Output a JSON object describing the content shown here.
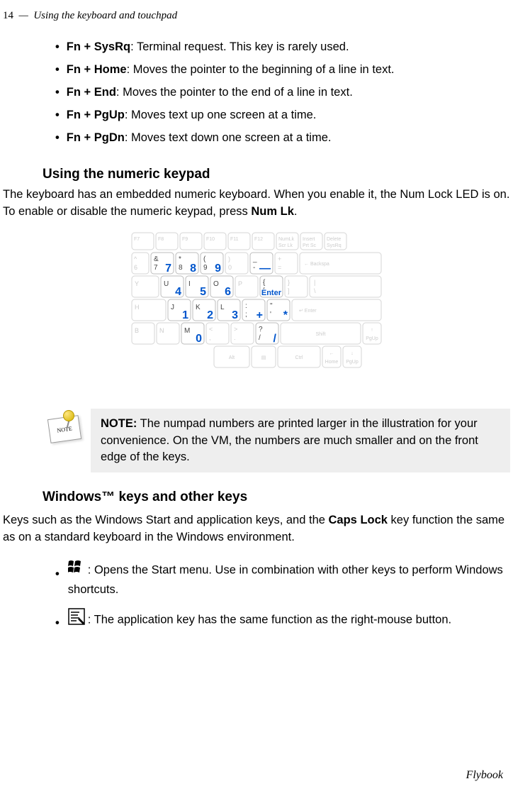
{
  "header": {
    "page_number": "14",
    "separator": "—",
    "chapter_title": "Using the keyboard and touchpad"
  },
  "bullets": {
    "items": [
      {
        "term": "Fn + SysRq",
        "desc": ": Terminal request. This key is rarely used."
      },
      {
        "term": "Fn + Home",
        "desc": ": Moves the pointer to the beginning of a line in text."
      },
      {
        "term": "Fn + End",
        "desc": ": Moves the pointer to the end of a line in text."
      },
      {
        "term": "Fn + PgUp",
        "desc": ": Moves text up one screen at a time."
      },
      {
        "term": "Fn + PgDn",
        "desc": ": Moves text down one screen at a time."
      }
    ]
  },
  "heading_numeric": "Using the numeric keypad",
  "para_numeric": {
    "pre": "The keyboard has an embedded numeric keyboard. When you enable it, the Num Lock LED is on. To enable or disable the numeric keypad, press ",
    "bold": "Num Lk",
    "post": "."
  },
  "note": {
    "label": "NOTE:",
    "text": " The numpad numbers are printed larger in the illustration for your convenience. On the VM, the numbers are much smaller and on the front edge of the keys.",
    "icon_text": "NOTE"
  },
  "heading_winkeys": "Windows™ keys and other keys",
  "para_winkeys": {
    "pre": "Keys such as the Windows Start and application keys, and the ",
    "bold": "Caps Lock",
    "post": " key function the same as on a standard keyboard in the Windows environment."
  },
  "winlist": {
    "items": [
      {
        "desc": ": Opens the Start menu. Use in combination with other keys to perform Windows shortcuts."
      },
      {
        "desc": ": The application key has the same function as the right-mouse button."
      }
    ]
  },
  "footer": "Flybook",
  "keyboard": {
    "fn_row": [
      {
        "label": "F7"
      },
      {
        "label": "F8"
      },
      {
        "label": "F9"
      },
      {
        "label": "F10"
      },
      {
        "label": "F11"
      },
      {
        "label": "F12"
      },
      {
        "label": "NumLk",
        "sub": "Scr Lk"
      },
      {
        "label": "Insert",
        "sub": "Prt Sc"
      },
      {
        "label": "Delete",
        "sub": "SysRq"
      }
    ],
    "row1": {
      "keys": [
        {
          "top": "^",
          "bottom": "6"
        },
        {
          "top": "&",
          "bottom": "7",
          "num": "7",
          "active": true
        },
        {
          "top": "*",
          "bottom": "8",
          "num": "8",
          "active": true
        },
        {
          "top": "(",
          "bottom": "9",
          "num": "9",
          "active": true
        },
        {
          "top": ")",
          "bottom": "0"
        },
        {
          "top": "_",
          "bottom": "-",
          "num": "—",
          "active": true
        },
        {
          "top": "+",
          "bottom": "="
        }
      ],
      "end": {
        "label": "← Backspa"
      }
    },
    "row2": {
      "start": {
        "label": "Y"
      },
      "keys": [
        {
          "label": "U",
          "num": "4",
          "active": true
        },
        {
          "label": "I",
          "num": "5",
          "active": true
        },
        {
          "label": "O",
          "num": "6",
          "active": true
        },
        {
          "label": "P"
        },
        {
          "top": "{",
          "bottom": "[",
          "num": "Enter",
          "active": true
        },
        {
          "top": "}",
          "bottom": "]"
        }
      ],
      "end": {
        "top": "|",
        "bottom": "\\"
      }
    },
    "row3": {
      "start": {
        "label": "H"
      },
      "keys": [
        {
          "label": "J",
          "num": "1",
          "active": true
        },
        {
          "label": "K",
          "num": "2",
          "active": true
        },
        {
          "label": "L",
          "num": "3",
          "active": true
        },
        {
          "top": ":",
          "bottom": ";",
          "num": "+",
          "active": true
        },
        {
          "top": "\"",
          "bottom": "'",
          "num": "*",
          "active": true
        }
      ],
      "end": {
        "label": "↵ Enter"
      }
    },
    "row4": {
      "keys": [
        {
          "label": "B"
        },
        {
          "label": "N"
        },
        {
          "label": "M",
          "num": "0",
          "active": true
        },
        {
          "top": "<",
          "bottom": ","
        },
        {
          "top": ">",
          "bottom": "."
        },
        {
          "top": "?",
          "bottom": "/",
          "num": "/",
          "active": true
        }
      ],
      "shift": {
        "label": "Shift"
      },
      "pgup": {
        "top": "↑",
        "bottom": "PgUp"
      }
    },
    "row5": {
      "keys": [
        {
          "label": "Alt"
        },
        {
          "label": "▤"
        },
        {
          "label": "Ctrl"
        },
        {
          "top": "←",
          "bottom": "Home"
        },
        {
          "top": "↓",
          "bottom": "PgUp"
        }
      ]
    }
  }
}
